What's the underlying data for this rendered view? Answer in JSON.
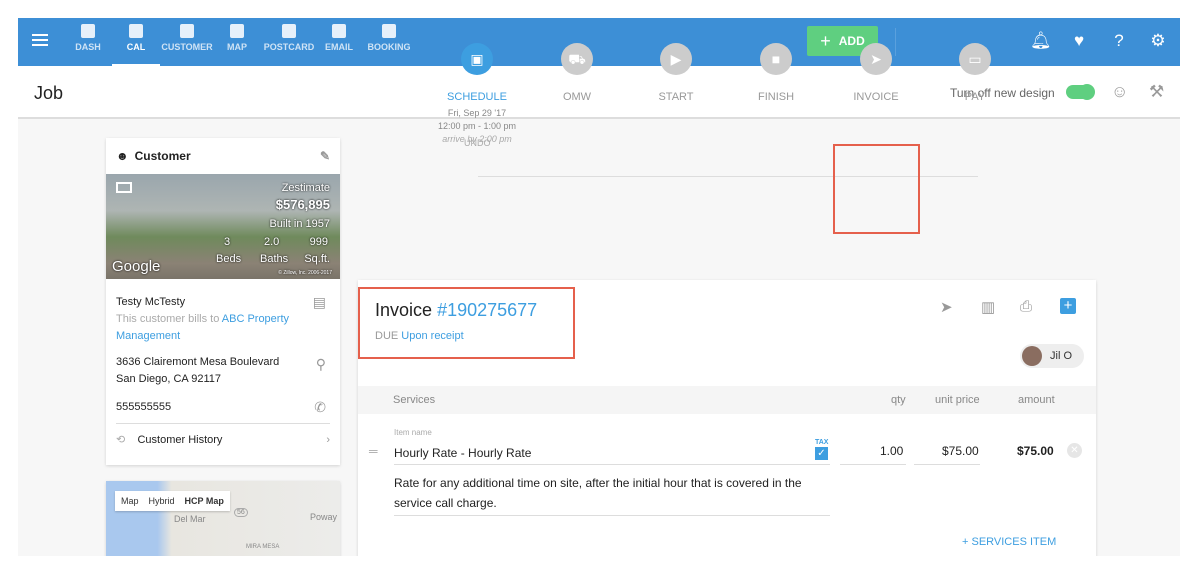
{
  "nav": {
    "items": [
      {
        "label": "DASH"
      },
      {
        "label": "CAL"
      },
      {
        "label": "CUSTOMER"
      },
      {
        "label": "MAP"
      },
      {
        "label": "POSTCARD"
      },
      {
        "label": "EMAIL"
      },
      {
        "label": "BOOKING"
      }
    ],
    "add_label": "ADD"
  },
  "header": {
    "title": "Job",
    "toggle_label": "Turn off new design"
  },
  "customer": {
    "heading": "Customer",
    "zestimate_label": "Zestimate",
    "zestimate": "$576,895",
    "built": "Built in 1957",
    "beds": "3",
    "beds_label": "Beds",
    "baths": "2.0",
    "baths_label": "Baths",
    "sqft": "999",
    "sqft_label": "Sq.ft.",
    "google": "Google",
    "copyright": "© Zillow, Inc. 2006-2017",
    "name": "Testy McTesty",
    "bills_prefix": "This customer bills to",
    "bills_to": "ABC Property Management",
    "address1": "3636 Clairemont Mesa Boulevard",
    "address2": "San Diego, CA 92117",
    "phone": "555555555",
    "history": "Customer History"
  },
  "map": {
    "tabs": [
      "Map",
      "Hybrid",
      "HCP Map"
    ],
    "labels": [
      "Del Mar",
      "Poway",
      "MIRA MESA",
      "56"
    ]
  },
  "timeline": {
    "undo": "UNDO",
    "steps": [
      {
        "label": "SCHEDULE",
        "date": "Fri, Sep 29 '17",
        "time": "12:00 pm - 1:00 pm",
        "arrive": "arrive by 2:00 pm"
      },
      {
        "label": "OMW"
      },
      {
        "label": "START"
      },
      {
        "label": "FINISH"
      },
      {
        "label": "INVOICE"
      },
      {
        "label": "PAY"
      }
    ]
  },
  "invoice": {
    "title": "Invoice",
    "number": "#190275677",
    "due_label": "DUE",
    "due": "Upon receipt",
    "assignee": "Jil O",
    "columns": {
      "services": "Services",
      "qty": "qty",
      "unit_price": "unit price",
      "amount": "amount"
    },
    "item": {
      "name_label": "Item name",
      "name": "Hourly Rate - Hourly Rate",
      "tax": "TAX",
      "qty": "1.00",
      "unit_price": "$75.00",
      "amount": "$75.00",
      "description": "Rate for any additional time on site, after the initial hour that is covered in the service call charge."
    },
    "add_item": "+ SERVICES ITEM"
  },
  "colors": {
    "brand": "#3d8fd6",
    "accent": "#3d9ee0",
    "add": "#5fcf80",
    "highlight": "#e5604c"
  }
}
